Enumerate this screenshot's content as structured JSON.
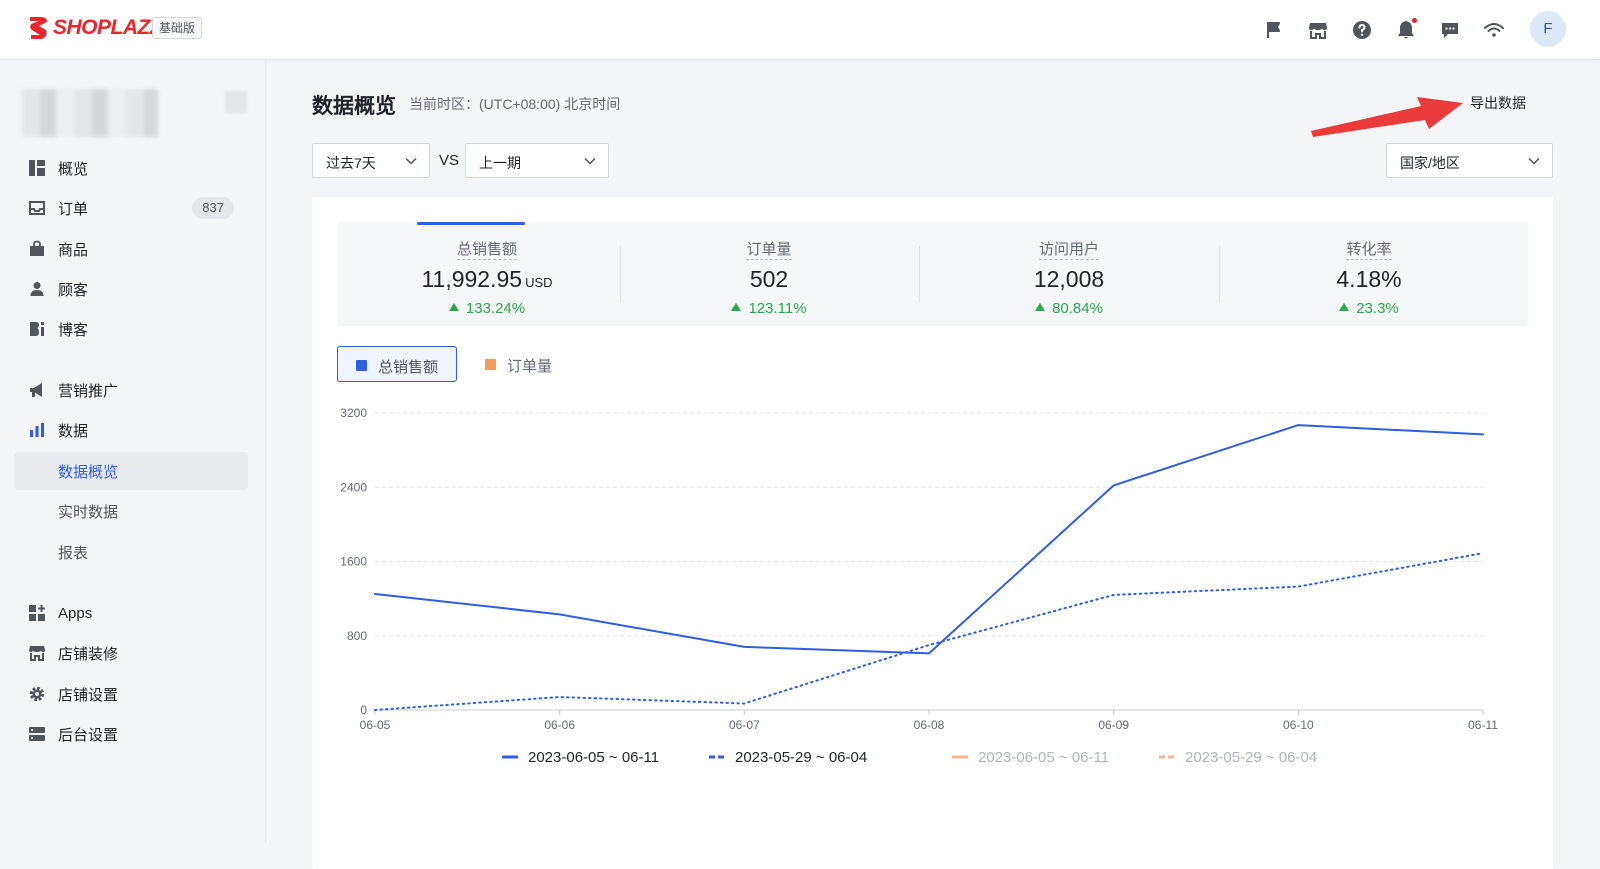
{
  "brand": {
    "name": "SHOPLAZZA",
    "plan": "基础版",
    "brand_color": "#e8262c"
  },
  "header": {
    "icons": [
      "flag-icon",
      "storefront-icon",
      "help-icon",
      "bell-icon",
      "chat-icon",
      "wifi-icon"
    ],
    "avatar_initial": "F"
  },
  "sidebar": {
    "items": [
      {
        "label": "概览",
        "icon": "dashboard-icon"
      },
      {
        "label": "订单",
        "icon": "inbox-icon",
        "badge": "837"
      },
      {
        "label": "商品",
        "icon": "bag-icon"
      },
      {
        "label": "顾客",
        "icon": "person-icon"
      },
      {
        "label": "博客",
        "icon": "blog-icon"
      },
      {
        "label": "营销推广",
        "icon": "megaphone-icon"
      },
      {
        "label": "数据",
        "icon": "bar-chart-icon"
      },
      {
        "label": "数据概览",
        "sub": true,
        "active": true
      },
      {
        "label": "实时数据",
        "sub": true
      },
      {
        "label": "报表",
        "sub": true
      },
      {
        "label": "Apps",
        "icon": "apps-icon"
      },
      {
        "label": "店铺装修",
        "icon": "store-icon"
      },
      {
        "label": "店铺设置",
        "icon": "gear-icon"
      },
      {
        "label": "后台设置",
        "icon": "server-icon"
      }
    ]
  },
  "page": {
    "title": "数据概览",
    "timezone": "当前时区：(UTC+08:00) 北京时间",
    "export_label": "导出数据"
  },
  "filters": {
    "period": "过去7天",
    "vs_label": "VS",
    "compare": "上一期",
    "region": "国家/地区"
  },
  "kpis": [
    {
      "label": "总销售额",
      "value": "11,992.95",
      "unit": "USD",
      "change": "133.24%"
    },
    {
      "label": "订单量",
      "value": "502",
      "change": "123.11%"
    },
    {
      "label": "访问用户",
      "value": "12,008",
      "change": "80.84%"
    },
    {
      "label": "转化率",
      "value": "4.18%",
      "change": "23.3%"
    }
  ],
  "metric_tabs": [
    {
      "label": "总销售额",
      "color": "#2f5fe0",
      "active": true
    },
    {
      "label": "订单量",
      "color": "#f59a5c",
      "active": false
    }
  ],
  "chart_data": {
    "type": "line",
    "x": [
      "06-05",
      "06-06",
      "06-07",
      "06-08",
      "06-09",
      "06-10",
      "06-11"
    ],
    "ylim": [
      0,
      3200
    ],
    "yticks": [
      0,
      800,
      1600,
      2400,
      3200
    ],
    "grid": true,
    "series": [
      {
        "name": "2023-06-05 ~ 06-11",
        "color": "#2f5fe0",
        "style": "solid",
        "visible": true,
        "values": [
          1250,
          1030,
          680,
          610,
          2420,
          3070,
          2970
        ]
      },
      {
        "name": "2023-05-29 ~ 06-04",
        "color": "#2f5fe0",
        "style": "dotted",
        "visible": true,
        "values": [
          0,
          140,
          70,
          700,
          1240,
          1330,
          1690
        ]
      },
      {
        "name": "2023-06-05 ~ 06-11",
        "color": "#f59a5c",
        "style": "solid",
        "visible": false,
        "values": []
      },
      {
        "name": "2023-05-29 ~ 06-04",
        "color": "#f59a5c",
        "style": "dashed",
        "visible": false,
        "values": []
      }
    ]
  }
}
